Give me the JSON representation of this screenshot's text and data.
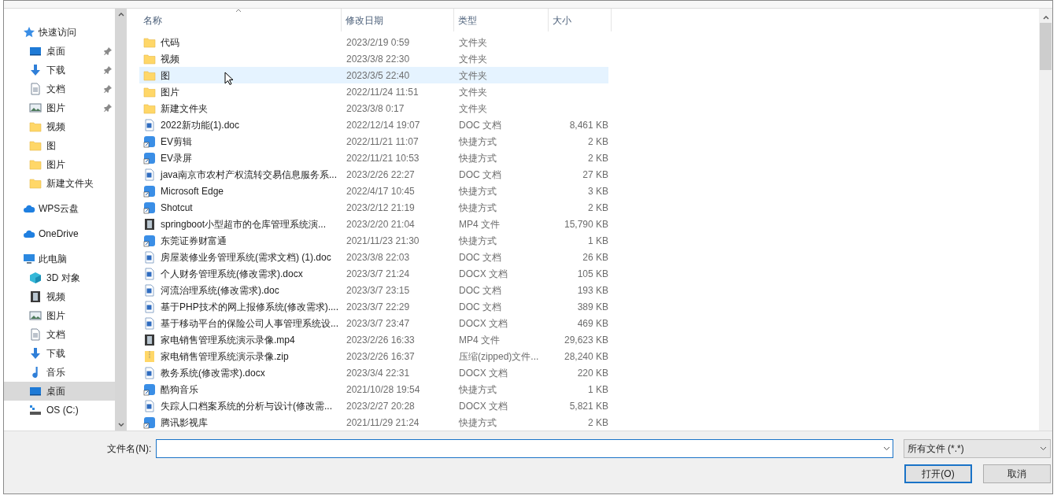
{
  "sidebar": {
    "groups": [
      {
        "label": "快速访问",
        "kind": "star",
        "selected": false,
        "children": [
          {
            "label": "桌面",
            "kind": "desktop",
            "pinned": true,
            "selected": false
          },
          {
            "label": "下载",
            "kind": "download",
            "pinned": true,
            "selected": false
          },
          {
            "label": "文档",
            "kind": "document",
            "pinned": true,
            "selected": false
          },
          {
            "label": "图片",
            "kind": "picture",
            "pinned": true,
            "selected": false
          },
          {
            "label": "视频",
            "kind": "folder",
            "pinned": false,
            "selected": false
          },
          {
            "label": "图",
            "kind": "folder",
            "pinned": false,
            "selected": false
          },
          {
            "label": "图片",
            "kind": "folder",
            "pinned": false,
            "selected": false
          },
          {
            "label": "新建文件夹",
            "kind": "folder",
            "pinned": false,
            "selected": false
          }
        ]
      },
      {
        "label": "WPS云盘",
        "kind": "cloud",
        "selected": false
      },
      {
        "label": "OneDrive",
        "kind": "cloud",
        "selected": false
      },
      {
        "label": "此电脑",
        "kind": "computer",
        "selected": false,
        "children": [
          {
            "label": "3D 对象",
            "kind": "cube",
            "pinned": false,
            "selected": false
          },
          {
            "label": "视频",
            "kind": "video",
            "pinned": false,
            "selected": false
          },
          {
            "label": "图片",
            "kind": "picture",
            "pinned": false,
            "selected": false
          },
          {
            "label": "文档",
            "kind": "document",
            "pinned": false,
            "selected": false
          },
          {
            "label": "下载",
            "kind": "download",
            "pinned": false,
            "selected": false
          },
          {
            "label": "音乐",
            "kind": "music",
            "pinned": false,
            "selected": false
          },
          {
            "label": "桌面",
            "kind": "desktop",
            "pinned": false,
            "selected": true
          },
          {
            "label": "OS (C:)",
            "kind": "drive",
            "pinned": false,
            "selected": false
          }
        ]
      }
    ]
  },
  "file_list": {
    "columns": [
      "名称",
      "修改日期",
      "类型",
      "大小"
    ],
    "rows": [
      {
        "name": "代码",
        "date": "2023/2/19 0:59",
        "type": "文件夹",
        "kind": "folder",
        "highlighted": false
      },
      {
        "name": "视频",
        "date": "2023/3/8 22:30",
        "type": "文件夹",
        "kind": "folder",
        "highlighted": false
      },
      {
        "name": "图",
        "date": "2023/3/5 22:40",
        "type": "文件夹",
        "kind": "folder",
        "highlighted": true
      },
      {
        "name": "图片",
        "date": "2022/11/24 11:51",
        "type": "文件夹",
        "kind": "folder",
        "highlighted": false
      },
      {
        "name": "新建文件夹",
        "date": "2023/3/8 0:17",
        "type": "文件夹",
        "kind": "folder",
        "highlighted": false
      },
      {
        "name": "2022新功能(1).doc",
        "date": "2022/12/14 19:07",
        "type": "DOC 文档",
        "size": "8,461 KB",
        "kind": "word",
        "highlighted": false
      },
      {
        "name": "EV剪辑",
        "date": "2022/11/21 11:07",
        "type": "快捷方式",
        "size": "2 KB",
        "kind": "shortcut",
        "highlighted": false
      },
      {
        "name": "EV录屏",
        "date": "2022/11/21 10:53",
        "type": "快捷方式",
        "size": "2 KB",
        "kind": "shortcut",
        "highlighted": false
      },
      {
        "name": "java南京市农村产权流转交易信息服务系...",
        "date": "2023/2/26 22:27",
        "type": "DOC 文档",
        "size": "27 KB",
        "kind": "word",
        "highlighted": false
      },
      {
        "name": "Microsoft Edge",
        "date": "2022/4/17 10:45",
        "type": "快捷方式",
        "size": "3 KB",
        "kind": "shortcut",
        "highlighted": false
      },
      {
        "name": "Shotcut",
        "date": "2023/2/12 21:19",
        "type": "快捷方式",
        "size": "2 KB",
        "kind": "shortcut",
        "highlighted": false
      },
      {
        "name": "springboot小型超市的仓库管理系统演...",
        "date": "2023/2/20 21:04",
        "type": "MP4 文件",
        "size": "15,790 KB",
        "kind": "video",
        "highlighted": false
      },
      {
        "name": "东莞证券财富通",
        "date": "2021/11/23 21:30",
        "type": "快捷方式",
        "size": "1 KB",
        "kind": "shortcut",
        "highlighted": false
      },
      {
        "name": "房屋装修业务管理系统(需求文档) (1).doc",
        "date": "2023/3/8 22:03",
        "type": "DOC 文档",
        "size": "26 KB",
        "kind": "word",
        "highlighted": false
      },
      {
        "name": "个人财务管理系统(修改需求).docx",
        "date": "2023/3/7 21:24",
        "type": "DOCX 文档",
        "size": "105 KB",
        "kind": "word",
        "highlighted": false
      },
      {
        "name": "河流治理系统(修改需求).doc",
        "date": "2023/3/7 23:15",
        "type": "DOC 文档",
        "size": "193 KB",
        "kind": "word",
        "highlighted": false
      },
      {
        "name": "基于PHP技术的网上报修系统(修改需求)....",
        "date": "2023/3/7 22:29",
        "type": "DOC 文档",
        "size": "389 KB",
        "kind": "word",
        "highlighted": false
      },
      {
        "name": "基于移动平台的保险公司人事管理系统设...",
        "date": "2023/3/7 23:47",
        "type": "DOCX 文档",
        "size": "469 KB",
        "kind": "word",
        "highlighted": false
      },
      {
        "name": "家电销售管理系统演示录像.mp4",
        "date": "2023/2/26 16:33",
        "type": "MP4 文件",
        "size": "29,623 KB",
        "kind": "video",
        "highlighted": false
      },
      {
        "name": "家电销售管理系统演示录像.zip",
        "date": "2023/2/26 16:37",
        "type": "压缩(zipped)文件...",
        "size": "28,240 KB",
        "kind": "zip",
        "highlighted": false
      },
      {
        "name": "教务系统(修改需求).docx",
        "date": "2023/3/4 22:31",
        "type": "DOCX 文档",
        "size": "220 KB",
        "kind": "word",
        "highlighted": false
      },
      {
        "name": "酷狗音乐",
        "date": "2021/10/28 19:54",
        "type": "快捷方式",
        "size": "1 KB",
        "kind": "shortcut",
        "highlighted": false
      },
      {
        "name": "失踪人口档案系统的分析与设计(修改需...",
        "date": "2023/2/27 20:28",
        "type": "DOCX 文档",
        "size": "5,821 KB",
        "kind": "word",
        "highlighted": false
      },
      {
        "name": "腾讯影视库",
        "date": "2021/11/29 21:24",
        "type": "快捷方式",
        "size": "2 KB",
        "kind": "shortcut",
        "highlighted": false
      }
    ]
  },
  "footer": {
    "filename_label": "文件名(N):",
    "filter": "所有文件 (*.*)",
    "buttons": [
      {
        "label": "打开(O)",
        "focused": true
      },
      {
        "label": "取消",
        "focused": false
      }
    ]
  }
}
